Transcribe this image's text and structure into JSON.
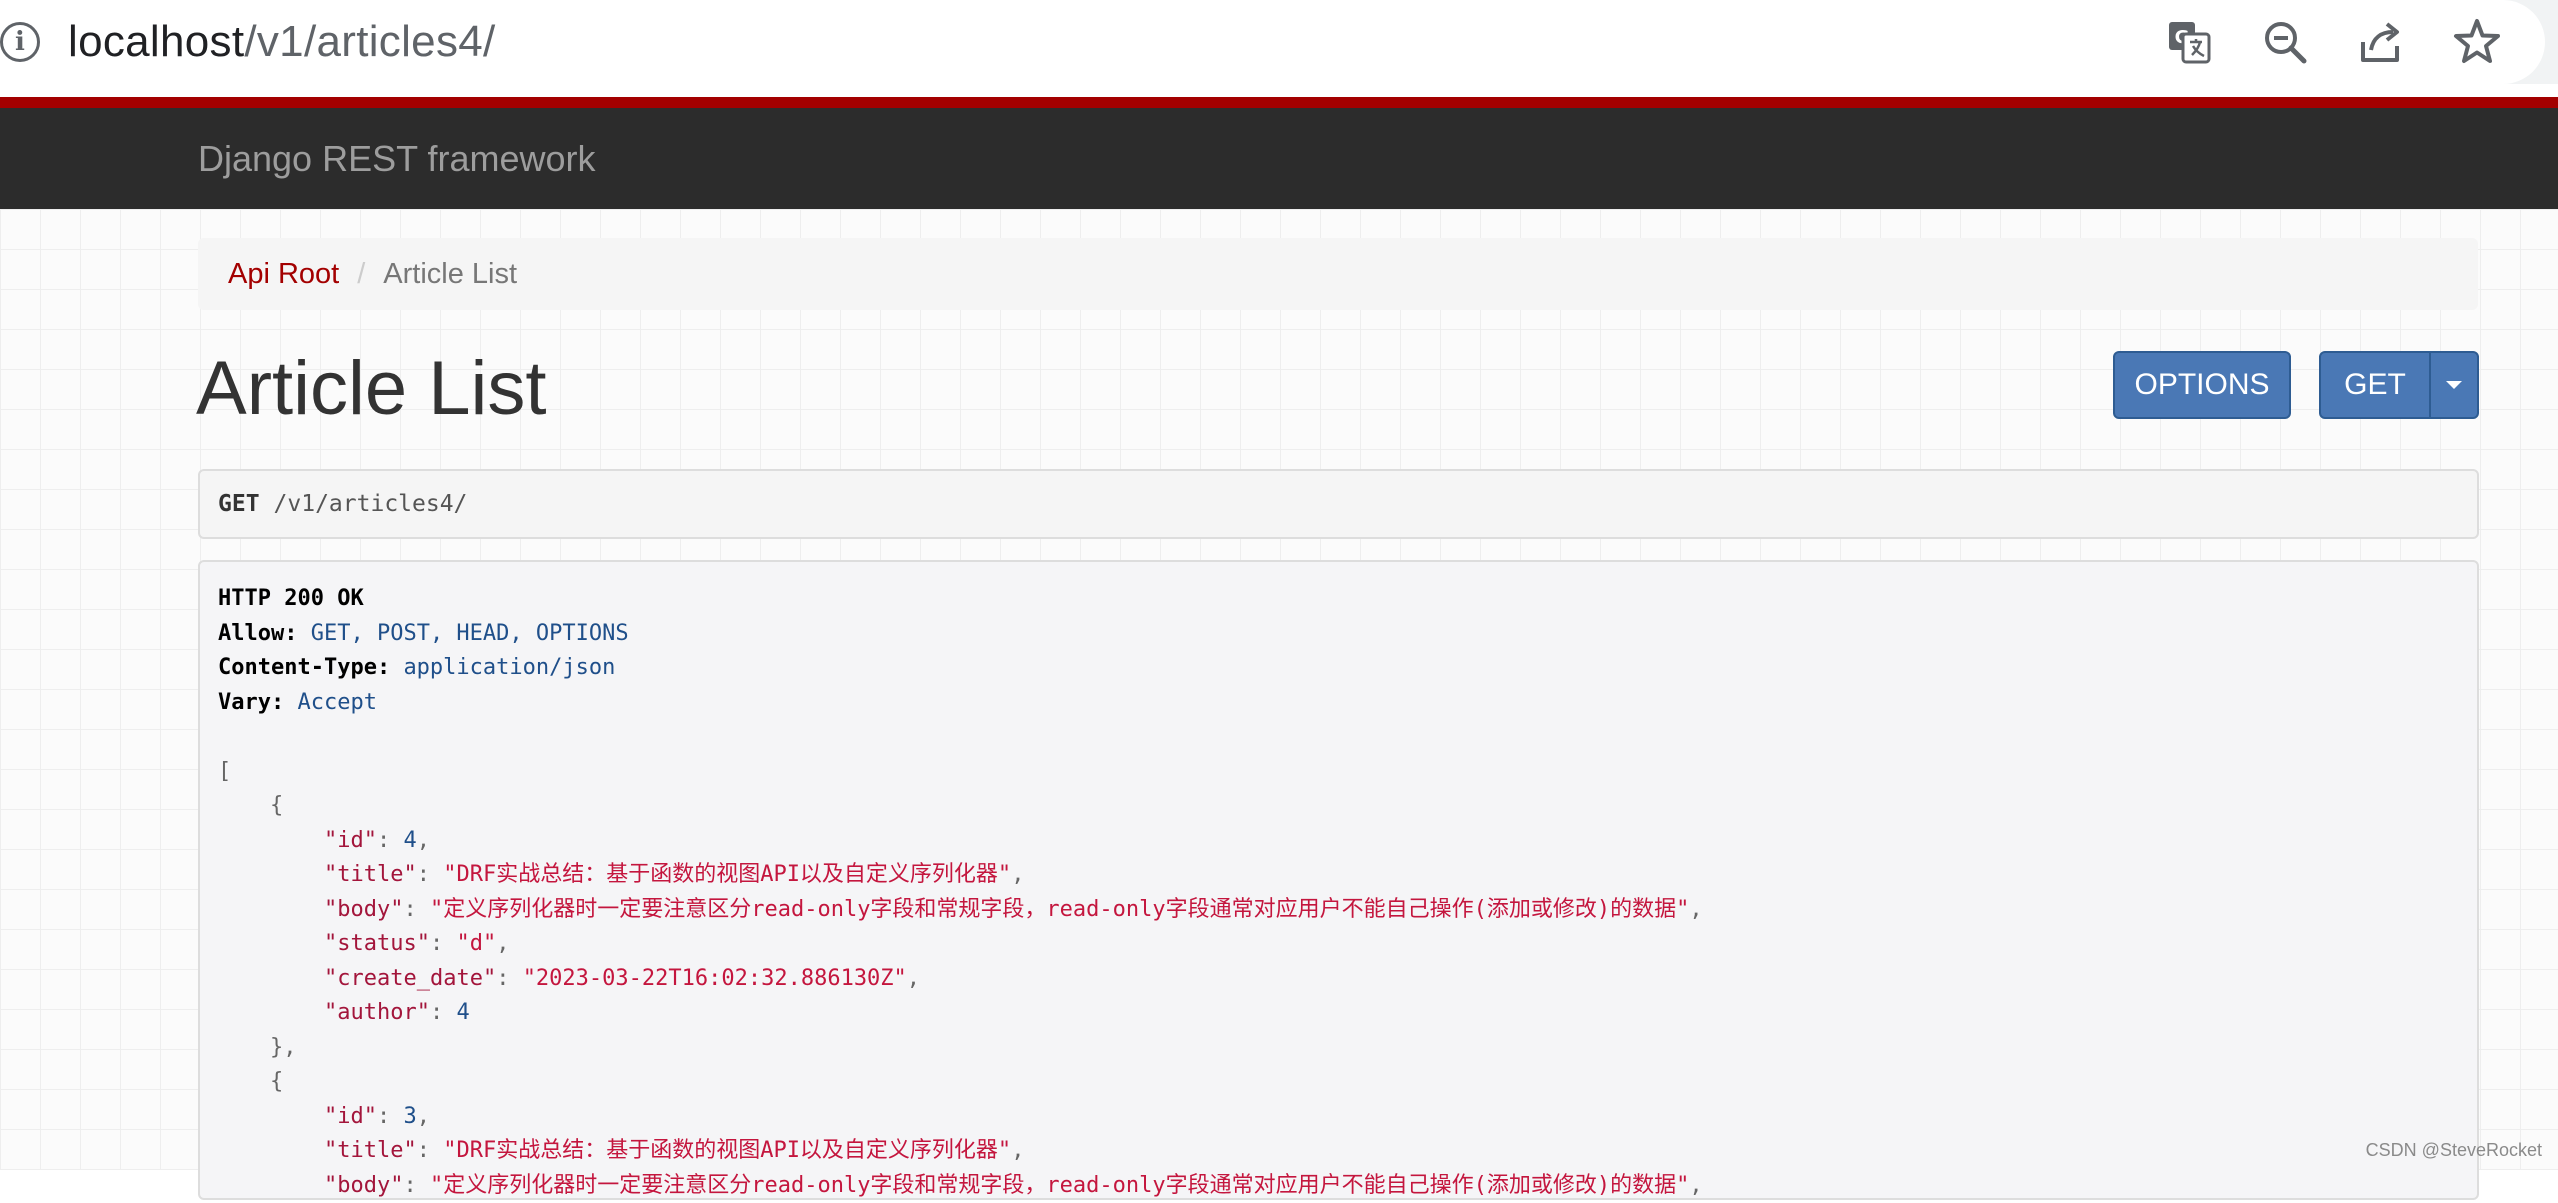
{
  "browser": {
    "url_host": "localhost",
    "url_path": "/v1/articles4/"
  },
  "navbar": {
    "brand": "Django REST framework"
  },
  "breadcrumb": {
    "root": "Api Root",
    "separator": "/",
    "current": "Article List"
  },
  "page": {
    "title": "Article List",
    "options_button": "OPTIONS",
    "get_button": "GET"
  },
  "request": {
    "method": "GET",
    "path": "/v1/articles4/"
  },
  "response": {
    "status": "HTTP 200 OK",
    "headers": [
      {
        "key": "Allow:",
        "value": "GET, POST, HEAD, OPTIONS"
      },
      {
        "key": "Content-Type:",
        "value": "application/json"
      },
      {
        "key": "Vary:",
        "value": "Accept"
      }
    ],
    "open_bracket": "[",
    "open_brace": "{",
    "close_brace_comma": "},",
    "items": [
      {
        "id": "4",
        "title": "\"DRF实战总结：基于函数的视图API以及自定义序列化器\"",
        "body": "\"定义序列化器时一定要注意区分read-only字段和常规字段，read-only字段通常对应用户不能自己操作(添加或修改)的数据\"",
        "status": "\"d\"",
        "create_date": "\"2023-03-22T16:02:32.886130Z\"",
        "author": "4"
      },
      {
        "id": "3",
        "title": "\"DRF实战总结：基于函数的视图API以及自定义序列化器\"",
        "body": "\"定义序列化器时一定要注意区分read-only字段和常规字段，read-only字段通常对应用户不能自己操作(添加或修改)的数据\""
      }
    ],
    "keys": {
      "id": "\"id\"",
      "title": "\"title\"",
      "body": "\"body\"",
      "status": "\"status\"",
      "create_date": "\"create_date\"",
      "author": "\"author\""
    }
  },
  "watermark": "CSDN @SteveRocket",
  "icons": {
    "info": "info-icon",
    "translate": "translate-icon",
    "zoom_out": "zoom-out-icon",
    "share": "share-icon",
    "bookmark": "star-icon"
  },
  "colors": {
    "navbar_accent": "#a30000",
    "navbar_bg": "#2c2c2c",
    "button_bg": "#4a78b5",
    "json_string": "#c4163e",
    "json_number": "#1f4f8a"
  }
}
